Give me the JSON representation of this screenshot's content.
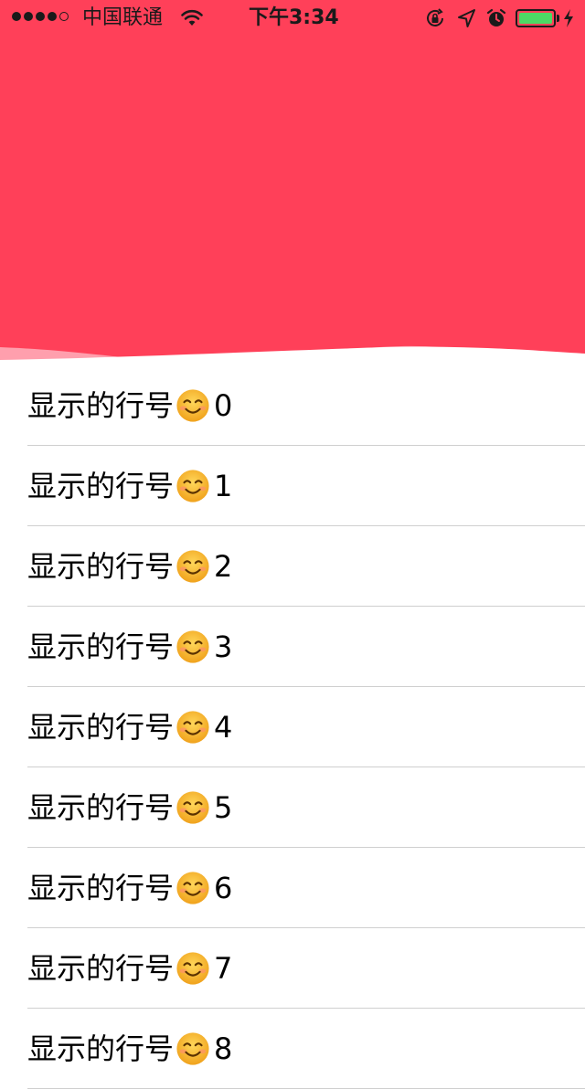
{
  "status_bar": {
    "carrier": "中国联通",
    "time": "下午3:34",
    "signal_bars_filled": 4,
    "signal_bars_total": 5,
    "battery_level": 1.0,
    "battery_color": "#4cd964"
  },
  "header": {
    "color": "#ff4059"
  },
  "list": {
    "item_prefix": "显示的行号",
    "emoji_icon": "smiling-face-icon",
    "rows": [
      {
        "number": "0"
      },
      {
        "number": "1"
      },
      {
        "number": "2"
      },
      {
        "number": "3"
      },
      {
        "number": "4"
      },
      {
        "number": "5"
      },
      {
        "number": "6"
      },
      {
        "number": "7"
      },
      {
        "number": "8"
      }
    ]
  }
}
